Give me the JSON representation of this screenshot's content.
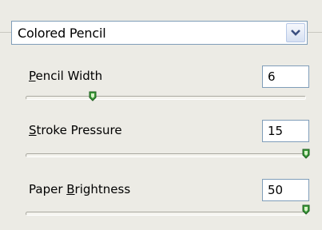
{
  "filter": {
    "selected": "Colored Pencil"
  },
  "controls": [
    {
      "label_pre": "",
      "mnemonic": "P",
      "label_post": "encil Width",
      "value": "6",
      "slider_fraction": 0.24
    },
    {
      "label_pre": "",
      "mnemonic": "S",
      "label_post": "troke Pressure",
      "value": "15",
      "slider_fraction": 1.0
    },
    {
      "label_pre": "Paper ",
      "mnemonic": "B",
      "label_post": "rightness",
      "value": "50",
      "slider_fraction": 1.0
    }
  ],
  "icons": {
    "dropdown_arrow": "chevron-down-icon",
    "slider_thumb": "slider-thumb-icon"
  },
  "colors": {
    "background": "#ecebe5",
    "input_border": "#7f9db9",
    "thumb_fill": "#3a9a3a"
  }
}
